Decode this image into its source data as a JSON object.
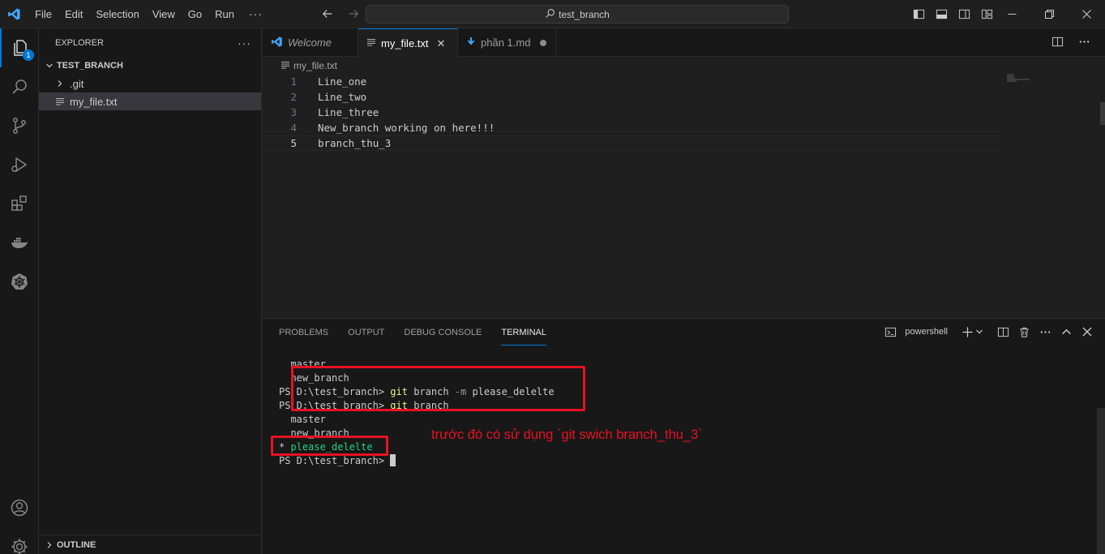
{
  "menu": {
    "items": [
      "File",
      "Edit",
      "Selection",
      "View",
      "Go",
      "Run"
    ],
    "more": "···"
  },
  "command_center": {
    "text": "test_branch"
  },
  "activity": {
    "explorer_badge": "1"
  },
  "sidebar": {
    "header": "EXPLORER",
    "more": "···",
    "section": "TEST_BRANCH",
    "items": [
      {
        "label": ".git"
      },
      {
        "label": "my_file.txt"
      }
    ],
    "outline": "OUTLINE"
  },
  "tabs": [
    {
      "label": "Welcome"
    },
    {
      "label": "my_file.txt",
      "close": "✕"
    },
    {
      "label": "phần 1.md"
    }
  ],
  "editor": {
    "breadcrumb": "my_file.txt",
    "lines": [
      {
        "n": "1",
        "text": "Line_one"
      },
      {
        "n": "2",
        "text": "Line_two"
      },
      {
        "n": "3",
        "text": "Line_three"
      },
      {
        "n": "4",
        "text": "New_branch working on here!!!"
      },
      {
        "n": "5",
        "text": "branch_thu_3"
      }
    ]
  },
  "panel": {
    "tabs": [
      "PROBLEMS",
      "OUTPUT",
      "DEBUG CONSOLE",
      "TERMINAL"
    ],
    "shell": "powershell"
  },
  "terminal": {
    "l1": "  master",
    "l2": "  new_branch",
    "l3_prompt": "PS D:\\test_branch> ",
    "l3_cmd": "git",
    "l3_mid": " branch ",
    "l3_flag": "-m",
    "l3_arg": " please_delelte",
    "l4_prompt": "PS D:\\test_branch> ",
    "l4_cmd": "git",
    "l4_arg": " branch",
    "l5": "  master",
    "l6": "  new_branch",
    "l7_star": "* ",
    "l7_branch": "please_delelte",
    "l8_prompt": "PS D:\\test_branch> "
  },
  "annotation": {
    "text": "trước đó có sử dụng `git swich branch_thu_3`",
    "color": "#e81123"
  },
  "colors": {
    "accent": "#0078d4",
    "terminal_green": "#23d18b",
    "terminal_yellow": "#f1ef8a"
  }
}
